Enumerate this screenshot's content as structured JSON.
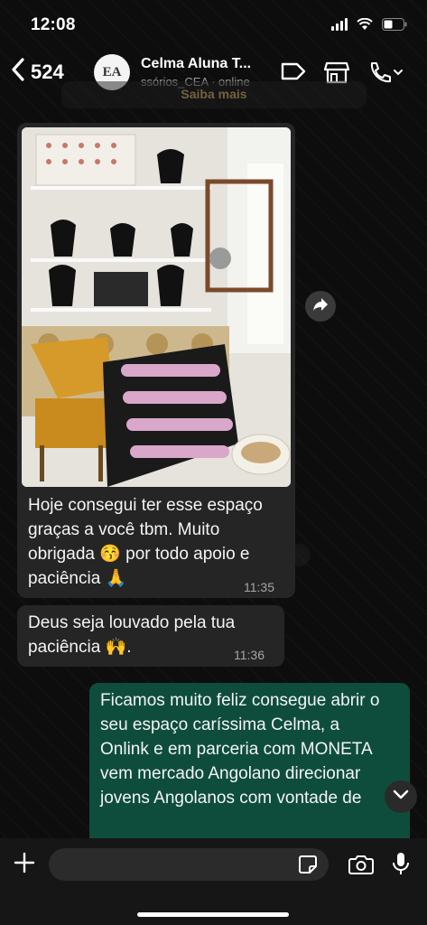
{
  "status_bar": {
    "time": "12:08"
  },
  "header": {
    "back_count": "524",
    "avatar_text": "EA",
    "contact_name": "Celma Aluna T...",
    "contact_status": "ssórios_CEA · online"
  },
  "banner": {
    "text": "Saiba mais"
  },
  "messages": [
    {
      "type": "image",
      "direction": "incoming",
      "alt": "photo of jewelry display shop"
    },
    {
      "direction": "incoming",
      "text": "Hoje consegui ter esse espaço graças a você tbm. Muito obrigada 😚 por todo apoio e paciência 🙏",
      "time": "11:35"
    },
    {
      "direction": "incoming",
      "text": "Deus seja louvado pela tua paciência 🙌.",
      "time": "11:36"
    },
    {
      "direction": "outgoing",
      "text": "Ficamos muito feliz consegue abrir o seu espaço caríssima Celma, a Onlink e em parceria com MONETA vem mercado Angolano direcionar jovens Angolanos com vontade de"
    }
  ],
  "composer": {
    "placeholder": ""
  },
  "colors": {
    "incoming_bubble": "#252525",
    "outgoing_bubble": "#0e4d3c",
    "background": "#0b0b0b"
  }
}
